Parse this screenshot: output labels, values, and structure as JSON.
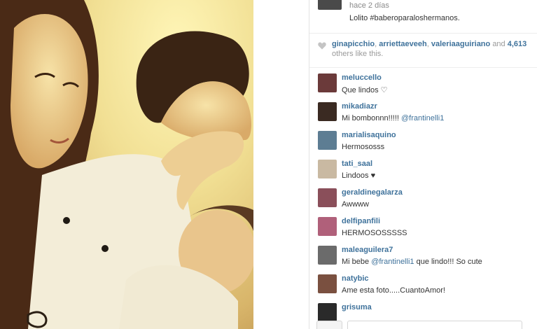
{
  "caption": {
    "time": "hace 2 días",
    "text": "Lolito #baberoparaloshermanos."
  },
  "likes": {
    "users": [
      "ginapicchio",
      "arriettaeveeh",
      "valeriaaguiriano"
    ],
    "separator": ", ",
    "and_text": "and",
    "count": "4,613",
    "suffix": "others like this."
  },
  "comments": [
    {
      "user": "meluccello",
      "text": "Que lindos ♡",
      "mention": "",
      "after": "",
      "avatar_color": "#6b3a3a"
    },
    {
      "user": "mikadiazr",
      "text": "Mi bombonnn!!!!!",
      "mention": "@frantinelli1",
      "after": "",
      "avatar_color": "#3a2a22"
    },
    {
      "user": "marialisaquino",
      "text": "Hermososss",
      "mention": "",
      "after": "",
      "avatar_color": "#5d7d93"
    },
    {
      "user": "tati_saal",
      "text": "Lindoos ♥",
      "mention": "",
      "after": "",
      "avatar_color": "#c9b9a2"
    },
    {
      "user": "geraldinegalarza",
      "text": "Awwww",
      "mention": "",
      "after": "",
      "avatar_color": "#8a4f5a"
    },
    {
      "user": "delfipanfili",
      "text": "HERMOSOSSSSS",
      "mention": "",
      "after": "",
      "avatar_color": "#b0607a"
    },
    {
      "user": "maleaguilera7",
      "text": "Mi bebe",
      "mention": "@frantinelli1",
      "after": "que lindo!!! So cute",
      "avatar_color": "#6b6b6b"
    },
    {
      "user": "natybic",
      "text": "Ame esta foto.....CuantoAmor!",
      "mention": "",
      "after": "",
      "avatar_color": "#7a5040"
    },
    {
      "user": "grisuma",
      "text": "",
      "mention": "",
      "after": "",
      "avatar_color": "#2a2a2a"
    }
  ],
  "colors": {
    "link": "#3f729b",
    "muted": "#9a9a9a"
  },
  "icons": {
    "like": "heart-icon"
  }
}
